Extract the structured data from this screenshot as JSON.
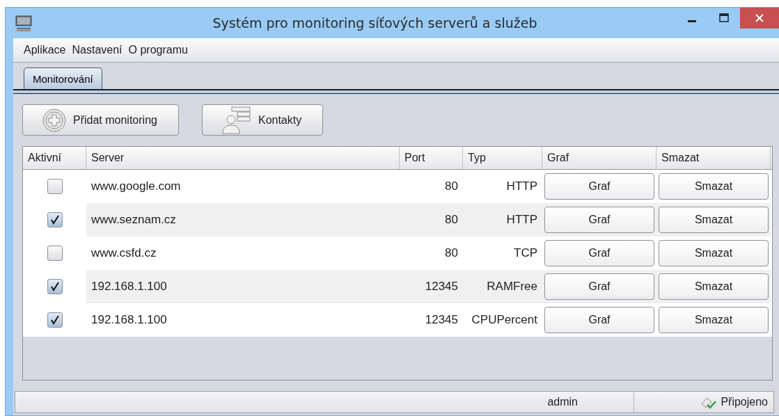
{
  "window": {
    "title": "Systém pro monitoring síťových serverů a služeb"
  },
  "menu": [
    "Aplikace",
    "Nastavení",
    "O programu"
  ],
  "tabs": [
    {
      "label": "Monitorování",
      "selected": true
    }
  ],
  "toolbar": [
    {
      "label": "Přidat monitoring"
    },
    {
      "label": "Kontakty"
    }
  ],
  "table": {
    "columns": [
      "Aktivní",
      "Server",
      "Port",
      "Typ",
      "Graf",
      "Smazat"
    ],
    "rows": [
      {
        "active": false,
        "server": "www.google.com",
        "port": "80",
        "type": "HTTP",
        "graph": "Graf",
        "delete": "Smazat"
      },
      {
        "active": true,
        "server": "www.seznam.cz",
        "port": "80",
        "type": "HTTP",
        "graph": "Graf",
        "delete": "Smazat"
      },
      {
        "active": false,
        "server": "www.csfd.cz",
        "port": "80",
        "type": "TCP",
        "graph": "Graf",
        "delete": "Smazat"
      },
      {
        "active": true,
        "server": "192.168.1.100",
        "port": "12345",
        "type": "RAMFree",
        "graph": "Graf",
        "delete": "Smazat"
      },
      {
        "active": true,
        "server": "192.168.1.100",
        "port": "12345",
        "type": "CPUPercent",
        "graph": "Graf",
        "delete": "Smazat"
      }
    ]
  },
  "status_bar": {
    "user": "admin",
    "connection": "Připojeno"
  }
}
